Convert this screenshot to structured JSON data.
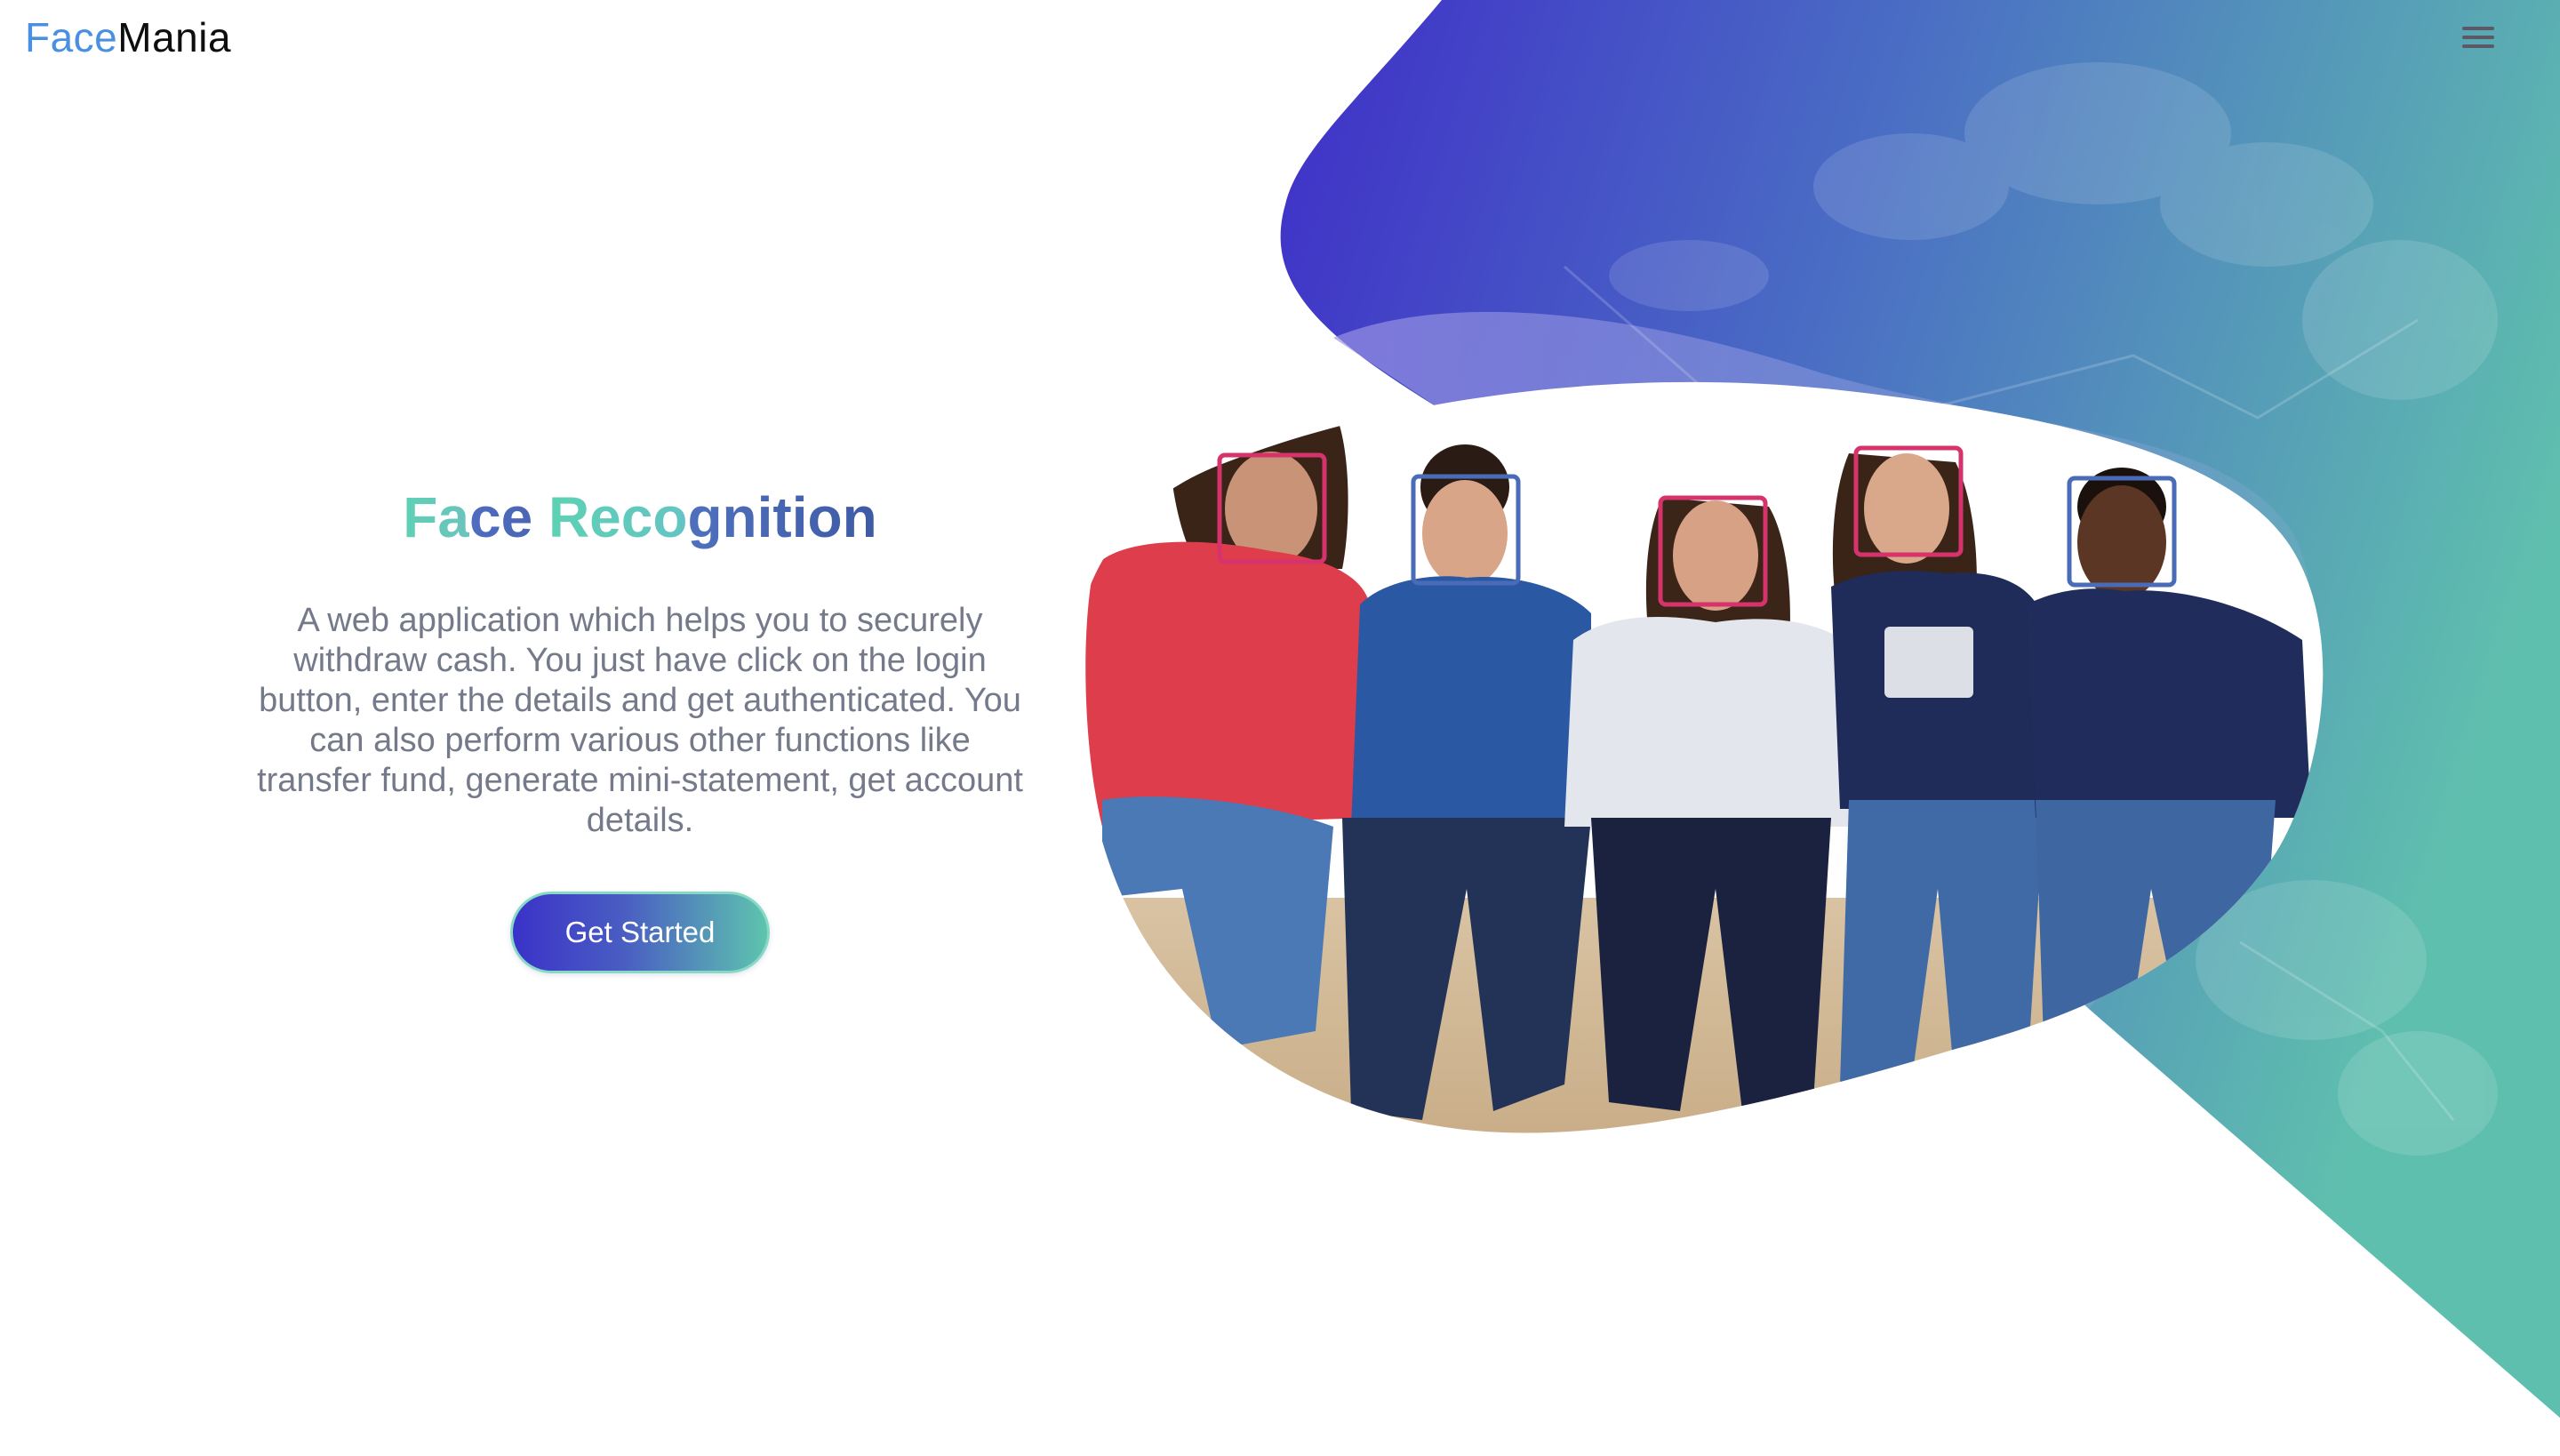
{
  "navbar": {
    "logo_part1": "Face",
    "logo_part2": "Mania",
    "menu_icon": "hamburger-menu-icon"
  },
  "hero": {
    "title_segments": [
      "Fa",
      "ce ",
      "Reco",
      "gnition"
    ],
    "description": "A web application which helps you to securely withdraw cash. You just have click on the login button, enter the details and get authenticated. You can also perform various other functions like transfer fund, generate mini-statement, get account details.",
    "cta_label": "Get Started"
  },
  "illustration": {
    "subject": "group-of-five-people-with-face-detection-boxes",
    "face_box_colors": [
      "#d6336c",
      "#4a6bb8",
      "#d6336c",
      "#d6336c",
      "#4a6bb8"
    ]
  },
  "colors": {
    "logo_accent": "#4a90e2",
    "logo_text": "#0e0e0e",
    "title_teal": "#5fd0b5",
    "title_blue": "#4a64b2",
    "body_text": "#757a8a",
    "gradient_start": "#3a32c9",
    "gradient_end": "#5ec4ae"
  }
}
